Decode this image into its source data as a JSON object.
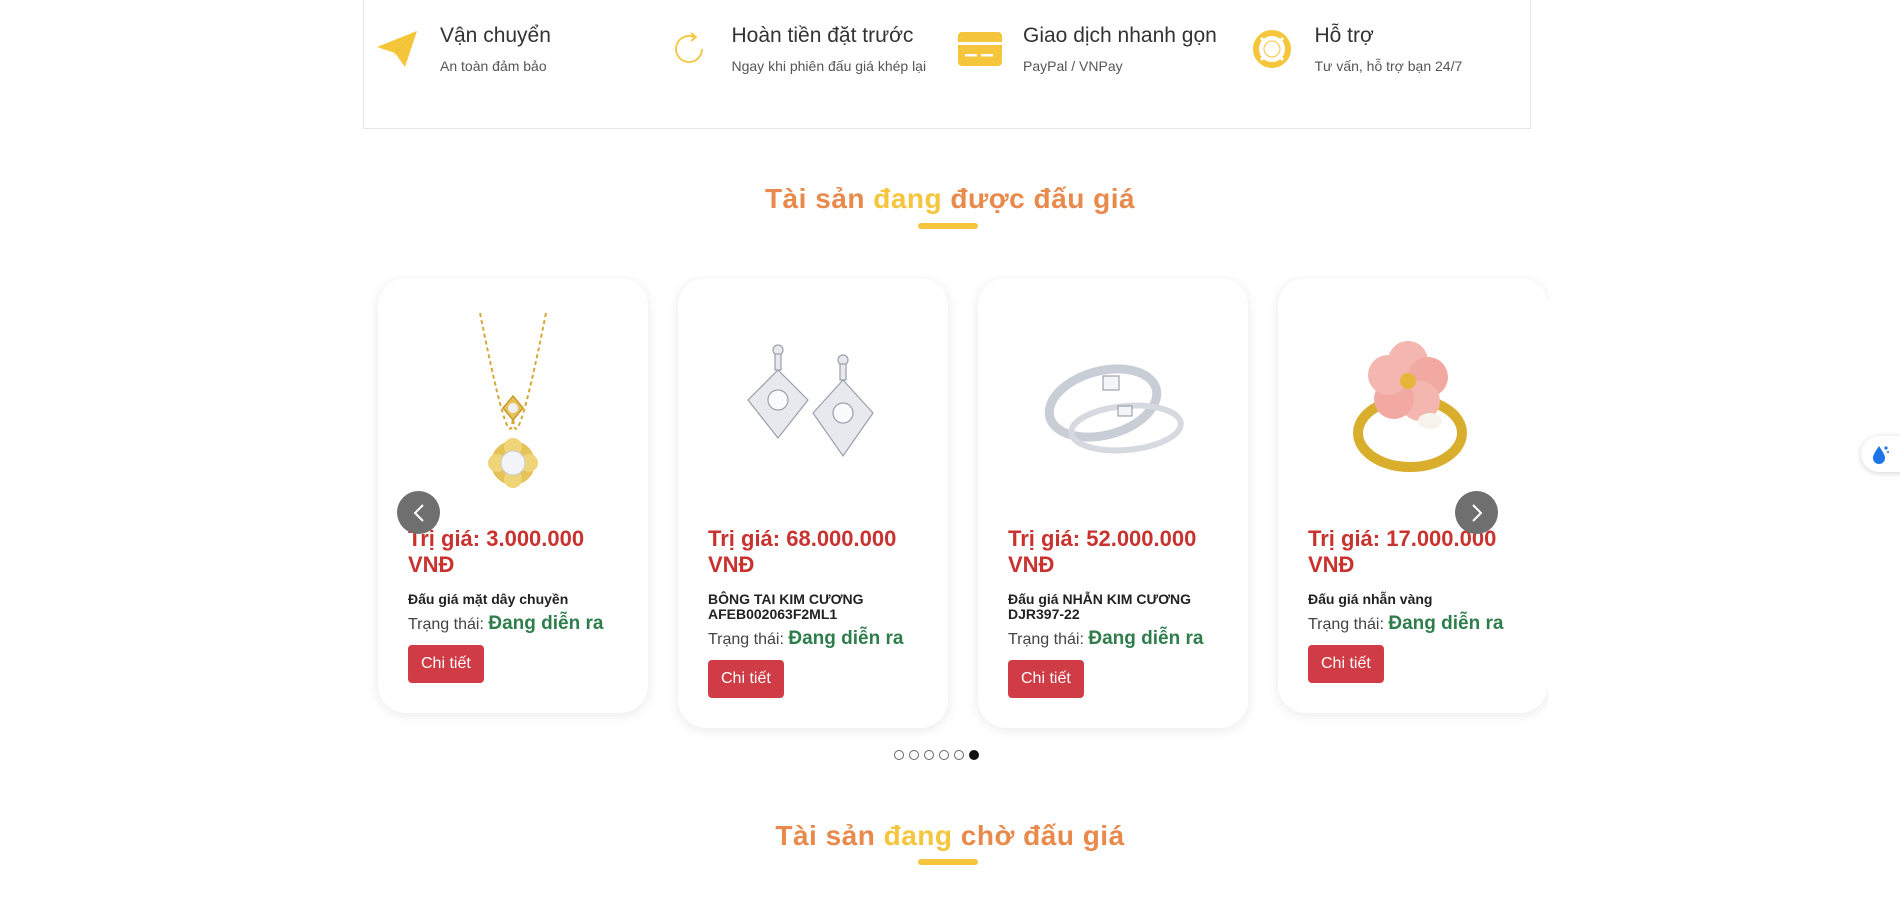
{
  "features": [
    {
      "icon": "paper-plane-icon",
      "title": "Vận chuyển",
      "subtitle": "An toàn đảm bảo"
    },
    {
      "icon": "refresh-icon",
      "title": "Hoàn tiền đặt trước",
      "subtitle": "Ngay khi phiên đấu giá khép lại"
    },
    {
      "icon": "credit-card-icon",
      "title": "Giao dịch nhanh gọn",
      "subtitle": "PayPal / VNPay"
    },
    {
      "icon": "lifebuoy-icon",
      "title": "Hỗ trợ",
      "subtitle": "Tư vấn, hỗ trợ bạn 24/7"
    }
  ],
  "ongoing_section": {
    "title_part1": "Tài sản ",
    "title_highlight": "đang",
    "title_part2": " được đấu giá"
  },
  "products": [
    {
      "image": "gold-pendant-necklace",
      "price": "Trị giá: 3.000.000 VNĐ",
      "name": "Đấu giá mặt dây chuyền",
      "status_label": "Trạng thái:",
      "status_value": "Đang diễn ra",
      "button": "Chi tiết"
    },
    {
      "image": "diamond-earrings",
      "price": "Trị giá: 68.000.000 VNĐ",
      "name": "BÔNG TAI KIM CƯƠNG AFEB002063F2ML1",
      "status_label": "Trạng thái:",
      "status_value": "Đang diễn ra",
      "button": "Chi tiết"
    },
    {
      "image": "diamond-couple-rings",
      "price": "Trị giá: 52.000.000 VNĐ",
      "name": "Đấu giá NHẪN KIM CƯƠNG DJR397-22",
      "status_label": "Trạng thái:",
      "status_value": "Đang diễn ra",
      "button": "Chi tiết"
    },
    {
      "image": "gold-flower-ring",
      "price": "Trị giá: 17.000.000 VNĐ",
      "name": "Đấu giá nhẫn vàng",
      "status_label": "Trạng thái:",
      "status_value": "Đang diễn ra",
      "button": "Chi tiết"
    }
  ],
  "carousel": {
    "dot_count": 6,
    "active_dot": 6
  },
  "upcoming_section": {
    "title_part1": "Tài sản ",
    "title_highlight": "đang",
    "title_part2": " chờ đấu giá"
  },
  "colors": {
    "accent_yellow": "#f5c53c",
    "heading_orange": "#e88a4c",
    "price_red": "#c8332f",
    "status_green": "#2e7d4b",
    "button_red": "#cf3c45"
  }
}
